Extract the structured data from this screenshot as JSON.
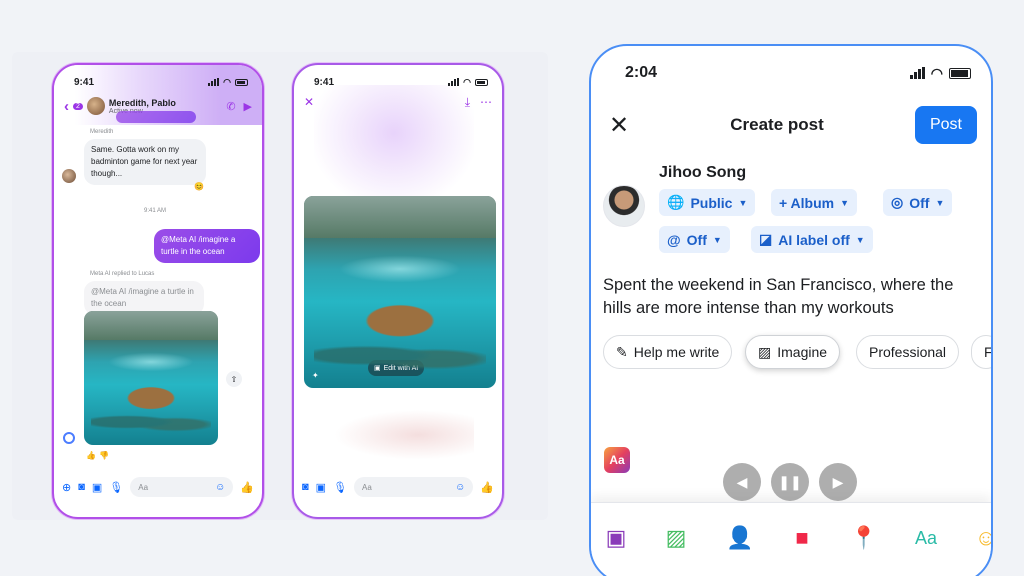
{
  "left_phone": {
    "time": "9:41",
    "chat_title": "Meredith, Pablo",
    "chat_status": "Active now",
    "back_count": "2",
    "sender_name": "Meredith",
    "message_in": "Same. Gotta work on my badminton game for next year though...",
    "timestamp": "9:41 AM",
    "message_out": "@Meta AI /imagine a turtle in the ocean",
    "reply_note": "Meta AI replied to Lucas",
    "quoted": "@Meta AI /imagine a turtle in the ocean",
    "composer_placeholder": "Aa"
  },
  "middle_phone": {
    "time": "9:41",
    "edit_label": "Edit with AI",
    "composer_placeholder": "Aa"
  },
  "right_phone": {
    "time": "2:04",
    "title": "Create post",
    "post_button": "Post",
    "user_name": "Jihoo Song",
    "chips": {
      "audience": "Public",
      "album": "+ Album",
      "instagram": "Off",
      "threads": "Off",
      "ai_label": "AI label off"
    },
    "post_text": "Spent the weekend in San Francisco, where the hills are more intense than my workouts",
    "pills": {
      "help": "Help me write",
      "imagine": "Imagine",
      "professional": "Professional",
      "clipped": "F"
    },
    "aa_badge": "Aa",
    "tray_text": "Aa"
  }
}
